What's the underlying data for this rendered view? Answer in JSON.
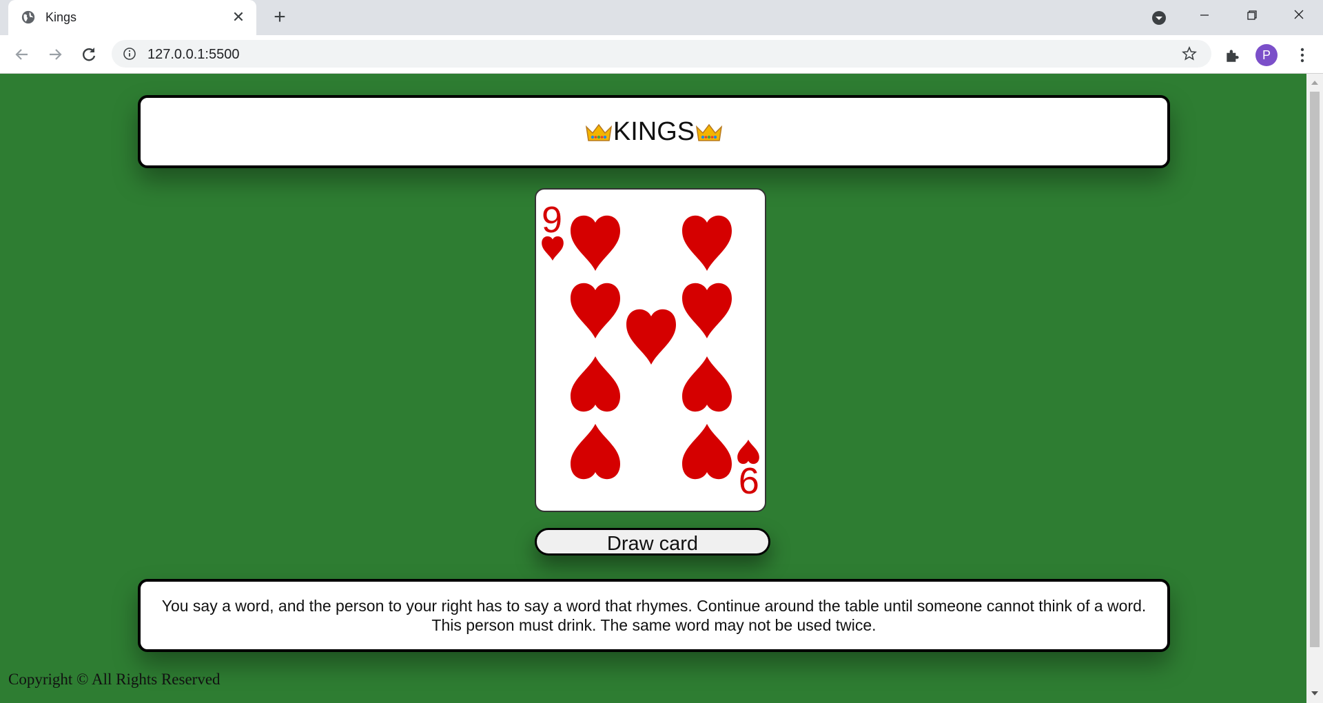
{
  "browser": {
    "tab_title": "Kings",
    "url": "127.0.0.1:5500",
    "profile_initial": "P"
  },
  "page": {
    "title": "KINGS",
    "card": {
      "rank": "9",
      "suit": "hearts",
      "color": "#d50000"
    },
    "draw_button_label": "Draw card",
    "rule_text": "You say a word, and the person to your right has to say a word that rhymes. Continue around the table until someone cannot think of a word. This person must drink. The same word may not be used twice.",
    "footer": "Copyright © All Rights Reserved"
  },
  "colors": {
    "background": "#2e7d32",
    "avatar": "#7b4fc9"
  }
}
